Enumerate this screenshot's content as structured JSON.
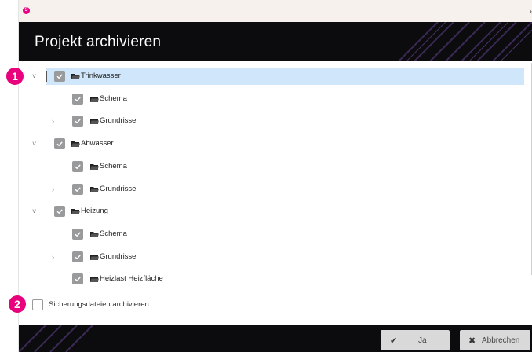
{
  "window": {
    "app_logo": "S",
    "close_glyph": "›"
  },
  "header": {
    "title": "Projekt archivieren"
  },
  "tree": {
    "groups": [
      {
        "label": "Trinkwasser",
        "expanded": true,
        "checked": true,
        "selected": true,
        "children": [
          {
            "label": "Schema",
            "checked": true,
            "expandable": false
          },
          {
            "label": "Grundrisse",
            "checked": true,
            "expandable": true
          }
        ]
      },
      {
        "label": "Abwasser",
        "expanded": true,
        "checked": true,
        "selected": false,
        "children": [
          {
            "label": "Schema",
            "checked": true,
            "expandable": false
          },
          {
            "label": "Grundrisse",
            "checked": true,
            "expandable": true
          }
        ]
      },
      {
        "label": "Heizung",
        "expanded": true,
        "checked": true,
        "selected": false,
        "children": [
          {
            "label": "Schema",
            "checked": true,
            "expandable": false
          },
          {
            "label": "Grundrisse",
            "checked": true,
            "expandable": true
          },
          {
            "label": "Heizlast Heizfläche",
            "checked": true,
            "expandable": false
          }
        ]
      }
    ],
    "chevron_expanded": "˅",
    "chevron_collapsed": "›",
    "icons": {
      "folder": "folder-open-icon",
      "check": "checkmark-icon"
    }
  },
  "options": {
    "backup_label": "Sicherungsdateien archivieren",
    "backup_checked": false
  },
  "badges": {
    "one": "1",
    "two": "2"
  },
  "buttons": {
    "yes_label": "Ja",
    "yes_icon": "✔",
    "cancel_label": "Abbrechen",
    "cancel_icon": "✖"
  },
  "colors": {
    "accent": "#e8007d",
    "header_bg": "#0c0c0e",
    "selection": "#cfe6fb",
    "checkbox": "#999a9c"
  }
}
